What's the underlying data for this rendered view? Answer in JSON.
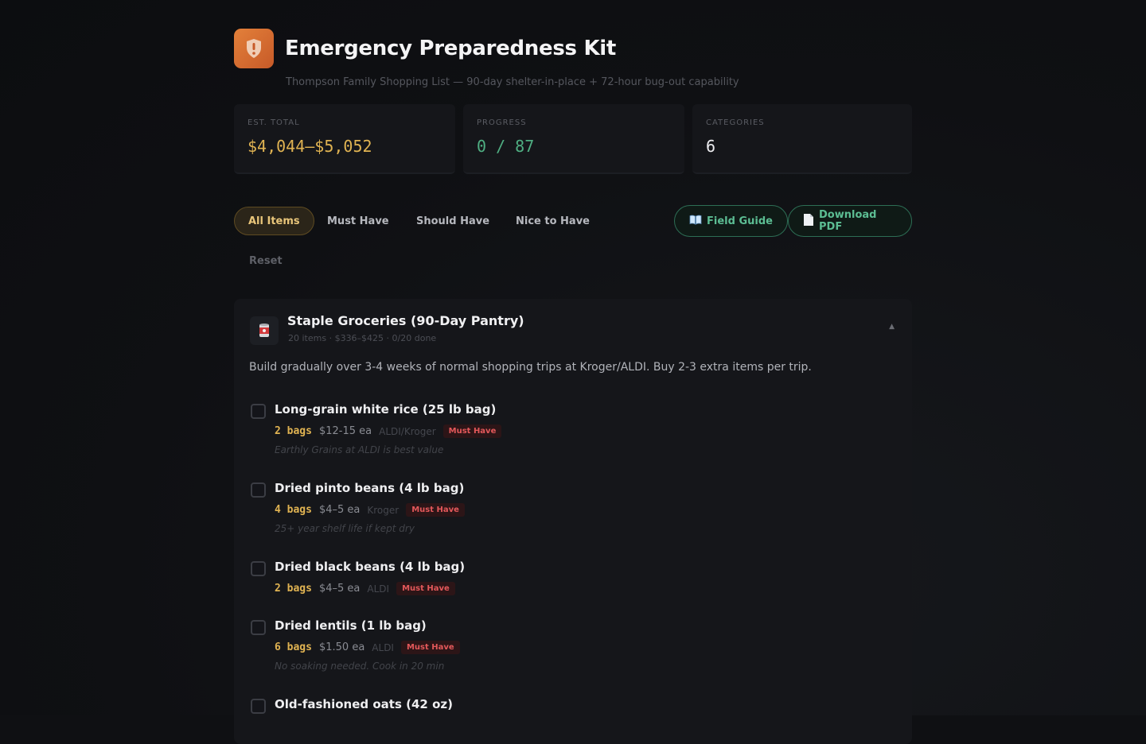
{
  "header": {
    "title": "Emergency Preparedness Kit",
    "subtitle": "Thompson Family Shopping List — 90-day shelter-in-place + 72-hour bug-out capability",
    "logo_icon": "shield-icon",
    "accent": "#e3803a"
  },
  "stats": [
    {
      "label": "EST. TOTAL",
      "value": "$4,044–$5,052",
      "color": "#e0b352"
    },
    {
      "label": "PROGRESS",
      "value": "0 / 87",
      "color": "#4fae82"
    },
    {
      "label": "CATEGORIES",
      "value": "6",
      "color": "#ececef"
    }
  ],
  "filters": {
    "chips": [
      "All Items",
      "Must Have",
      "Should Have",
      "Nice to Have"
    ],
    "active": "All Items",
    "reset_label": "Reset"
  },
  "actions": {
    "field_guide": {
      "label": "Field Guide",
      "icon": "book-icon"
    },
    "download_pdf": {
      "label": "Download PDF",
      "icon": "document-icon"
    }
  },
  "category": {
    "icon": "can-icon",
    "title": "Staple Groceries (90-Day Pantry)",
    "meta": "20 items · $336–$425 · 0/20 done",
    "description": "Build gradually over 3-4 weeks of normal shopping trips at Kroger/ALDI. Buy 2-3 extra items per trip.",
    "items": [
      {
        "name": "Long-grain white rice (25 lb bag)",
        "qty": "2 bags",
        "price": "$12-15 ea",
        "store": "ALDI/Kroger",
        "priority": "Must Have",
        "note": "Earthly Grains at ALDI is best value"
      },
      {
        "name": "Dried pinto beans (4 lb bag)",
        "qty": "4 bags",
        "price": "$4–5 ea",
        "store": "Kroger",
        "priority": "Must Have",
        "note": "25+ year shelf life if kept dry"
      },
      {
        "name": "Dried black beans (4 lb bag)",
        "qty": "2 bags",
        "price": "$4–5 ea",
        "store": "ALDI",
        "priority": "Must Have",
        "note": ""
      },
      {
        "name": "Dried lentils (1 lb bag)",
        "qty": "6 bags",
        "price": "$1.50 ea",
        "store": "ALDI",
        "priority": "Must Have",
        "note": "No soaking needed. Cook in 20 min"
      },
      {
        "name": "Old-fashioned oats (42 oz)",
        "qty": "",
        "price": "",
        "store": "",
        "priority": "",
        "note": ""
      }
    ]
  }
}
